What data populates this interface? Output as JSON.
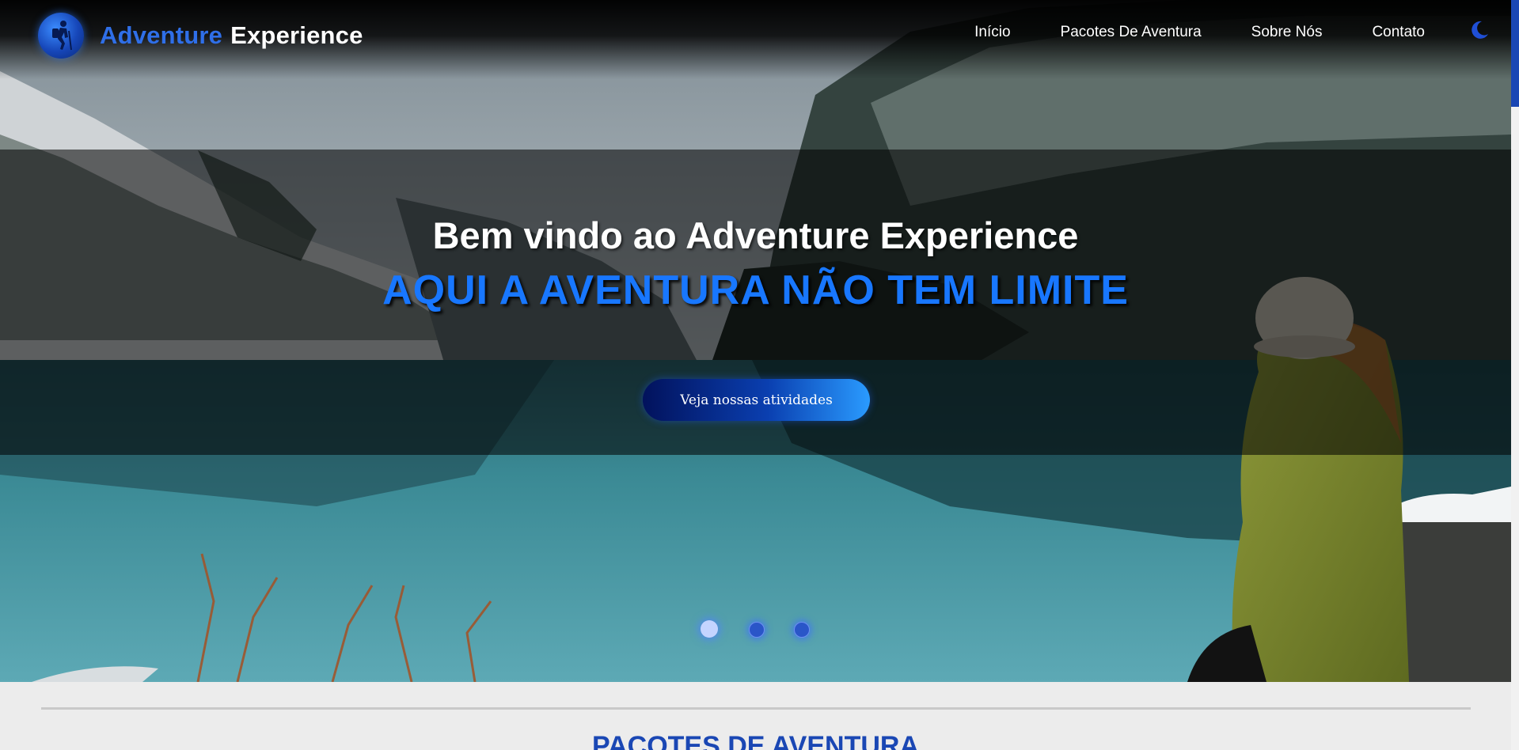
{
  "brand": {
    "name_part1": "Adventure",
    "name_part2": "Experience",
    "logo_icon": "hiker-icon"
  },
  "nav": {
    "items": [
      {
        "label": "Início"
      },
      {
        "label": "Pacotes De Aventura"
      },
      {
        "label": "Sobre Nós"
      },
      {
        "label": "Contato"
      }
    ],
    "theme_toggle_icon": "moon-icon"
  },
  "hero": {
    "title": "Bem vindo ao Adventure Experience",
    "subtitle": "AQUI A AVENTURA NÃO TEM LIMITE",
    "cta_label": "Veja nossas atividades",
    "slides": {
      "count": 3,
      "active_index": 0
    }
  },
  "packages_section": {
    "title": "PACOTES DE AVENTURA"
  },
  "colors": {
    "accent": "#1877ff",
    "brand_blue": "#2f6fe8",
    "section_title": "#1a47b4",
    "page_bg": "#ececec"
  }
}
